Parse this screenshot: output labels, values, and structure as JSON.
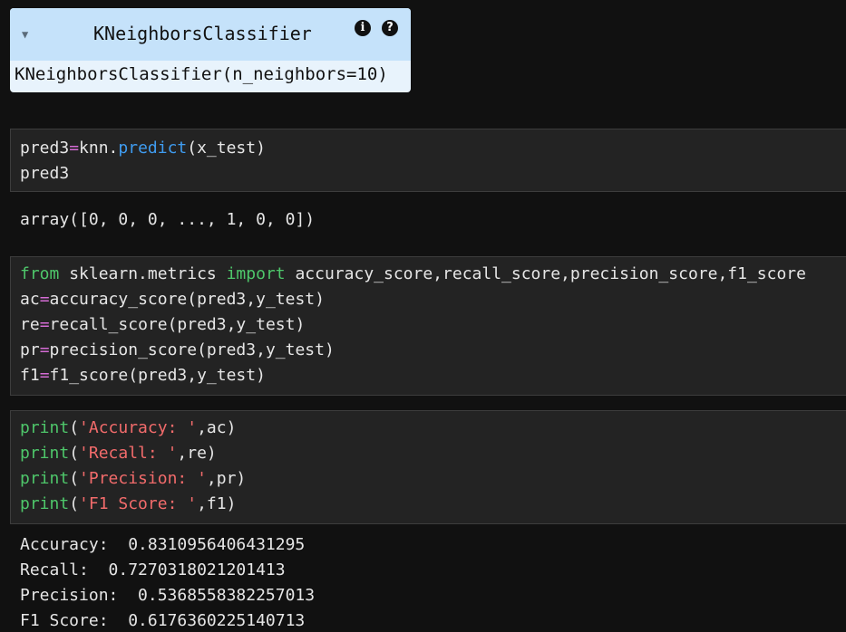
{
  "estimator": {
    "name": "KNeighborsClassifier",
    "repr": "KNeighborsClassifier(n_neighbors=10)",
    "info_icon": "i",
    "help_icon": "?"
  },
  "cell1": {
    "lines": [
      [
        {
          "t": "pred3",
          "c": ""
        },
        {
          "t": "=",
          "c": "op"
        },
        {
          "t": "knn.",
          "c": ""
        },
        {
          "t": "predict",
          "c": "fn"
        },
        {
          "t": "(x_test)",
          "c": ""
        }
      ],
      [
        {
          "t": "pred3",
          "c": ""
        }
      ]
    ]
  },
  "output1": "array([0, 0, 0, ..., 1, 0, 0])",
  "cell2": {
    "lines": [
      [
        {
          "t": "from",
          "c": "kw"
        },
        {
          "t": " sklearn.metrics ",
          "c": ""
        },
        {
          "t": "import",
          "c": "kw"
        },
        {
          "t": " accuracy_score,recall_score,precision_score,f1_score",
          "c": ""
        }
      ],
      [
        {
          "t": "ac",
          "c": ""
        },
        {
          "t": "=",
          "c": "op"
        },
        {
          "t": "accuracy_score(pred3,y_test)",
          "c": ""
        }
      ],
      [
        {
          "t": "re",
          "c": ""
        },
        {
          "t": "=",
          "c": "op"
        },
        {
          "t": "recall_score(pred3,y_test)",
          "c": ""
        }
      ],
      [
        {
          "t": "pr",
          "c": ""
        },
        {
          "t": "=",
          "c": "op"
        },
        {
          "t": "precision_score(pred3,y_test)",
          "c": ""
        }
      ],
      [
        {
          "t": "f1",
          "c": ""
        },
        {
          "t": "=",
          "c": "op"
        },
        {
          "t": "f1_score(pred3,y_test)",
          "c": ""
        }
      ]
    ]
  },
  "cell3": {
    "lines": [
      [
        {
          "t": "print",
          "c": "bi"
        },
        {
          "t": "(",
          "c": ""
        },
        {
          "t": "'Accuracy: '",
          "c": "str"
        },
        {
          "t": ",ac)",
          "c": ""
        }
      ],
      [
        {
          "t": "print",
          "c": "bi"
        },
        {
          "t": "(",
          "c": ""
        },
        {
          "t": "'Recall: '",
          "c": "str"
        },
        {
          "t": ",re)",
          "c": ""
        }
      ],
      [
        {
          "t": "print",
          "c": "bi"
        },
        {
          "t": "(",
          "c": ""
        },
        {
          "t": "'Precision: '",
          "c": "str"
        },
        {
          "t": ",pr)",
          "c": ""
        }
      ],
      [
        {
          "t": "print",
          "c": "bi"
        },
        {
          "t": "(",
          "c": ""
        },
        {
          "t": "'F1 Score: '",
          "c": "str"
        },
        {
          "t": ",f1)",
          "c": ""
        }
      ]
    ]
  },
  "output3": [
    "Accuracy:  0.8310956406431295",
    "Recall:  0.7270318021201413",
    "Precision:  0.5368558382257013",
    "F1 Score:  0.6176360225140713"
  ],
  "colors": {
    "background": "#111111",
    "cell_bg": "#232323",
    "keyword": "#4ec66a",
    "operator": "#d66cd6",
    "function": "#3f9cf0",
    "string": "#f26b6b",
    "estimator_header": "#c5e2fa",
    "estimator_body": "#e8f3fc"
  }
}
